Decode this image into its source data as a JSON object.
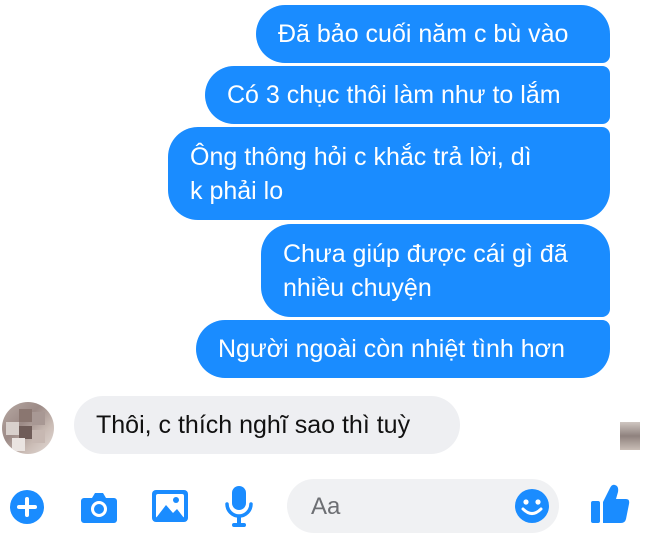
{
  "messages_outgoing": [
    {
      "text": "Đã bảo cuối năm c bù vào"
    },
    {
      "text": "Có 3 chục thôi làm như to lắm"
    },
    {
      "text": "Ông thông hỏi c khắc trả lời, dì k phải lo"
    },
    {
      "text": "Chưa giúp được cái gì đã nhiều chuyện"
    },
    {
      "text": "Người ngoài còn nhiệt tình hơn"
    }
  ],
  "message_incoming": {
    "text": "Thôi, c thích nghĩ sao thì tuỳ"
  },
  "composer": {
    "placeholder": "Aa"
  },
  "colors": {
    "outgoing_bubble": "#1a8cff",
    "incoming_bubble": "#eeeff2",
    "accent": "#1a8cff"
  },
  "icons": [
    "plus-icon",
    "camera-icon",
    "image-icon",
    "microphone-icon",
    "emoji-icon",
    "thumbs-up-icon"
  ]
}
